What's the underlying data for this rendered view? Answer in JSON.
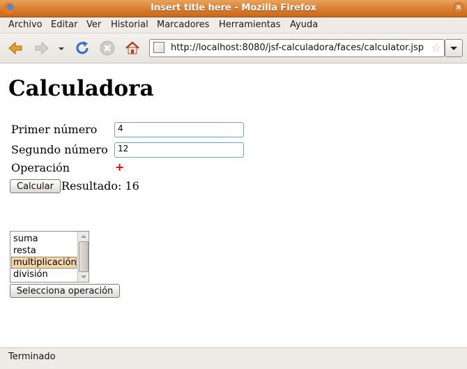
{
  "window": {
    "title": "Insert title here - Mozilla Firefox"
  },
  "menu": [
    "Archivo",
    "Editar",
    "Ver",
    "Historial",
    "Marcadores",
    "Herramientas",
    "Ayuda"
  ],
  "toolbar": {
    "url": "http://localhost:8080/jsf-calculadora/faces/calculator.jsp"
  },
  "page": {
    "heading": "Calculadora",
    "first_label": "Primer número",
    "first_value": "4",
    "second_label": "Segundo número",
    "second_value": "12",
    "op_label": "Operación",
    "op_value": "+",
    "calc_button": "Calcular",
    "result_label": "Resultado: 16",
    "operations": [
      "suma",
      "resta",
      "multiplicación",
      "división"
    ],
    "selected_operation": "multiplicación",
    "select_button": "Selecciona operación"
  },
  "status": "Terminado",
  "colors": {
    "titlebar": "#d87a2c",
    "operation_symbol": "#e00000",
    "selected_option": "#f4d7a8"
  },
  "icons": [
    "firefox-icon",
    "back-arrow-icon",
    "forward-arrow-icon",
    "history-dropdown-icon",
    "reload-icon",
    "stop-icon",
    "home-icon",
    "site-identity-icon",
    "bookmark-star-icon",
    "window-close-icon"
  ]
}
